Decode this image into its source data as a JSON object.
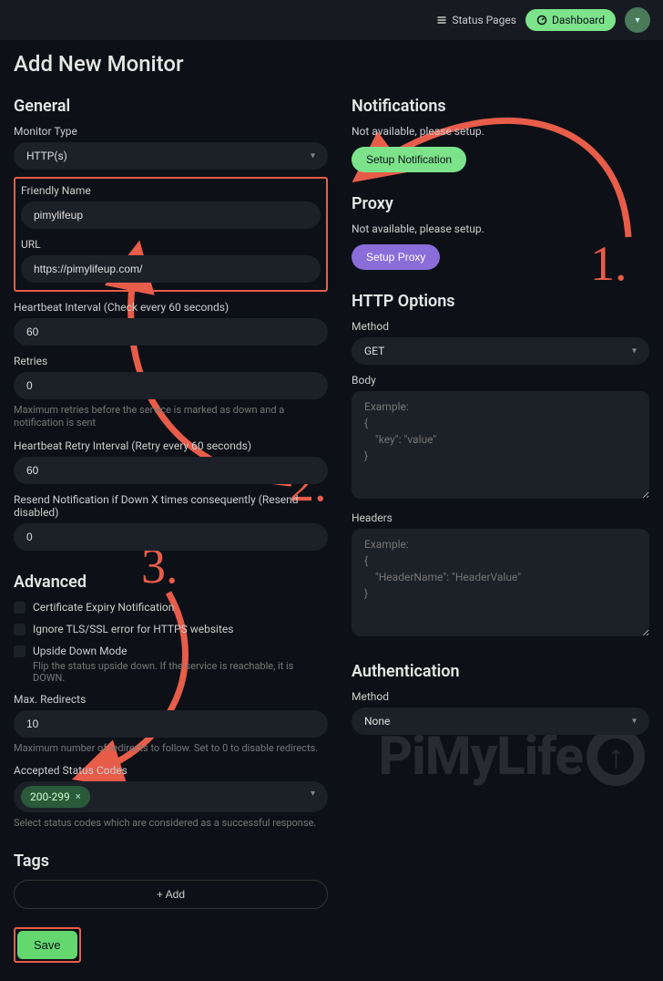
{
  "topbar": {
    "status_pages": "Status Pages",
    "dashboard": "Dashboard"
  },
  "page_title": "Add New Monitor",
  "general": {
    "heading": "General",
    "monitor_type_label": "Monitor Type",
    "monitor_type_value": "HTTP(s)",
    "friendly_name_label": "Friendly Name",
    "friendly_name_value": "pimylifeup",
    "url_label": "URL",
    "url_value": "https://pimylifeup.com/",
    "heartbeat_interval_label": "Heartbeat Interval (Check every 60 seconds)",
    "heartbeat_interval_value": "60",
    "retries_label": "Retries",
    "retries_value": "0",
    "retries_hint": "Maximum retries before the service is marked as down and a notification is sent",
    "retry_interval_label": "Heartbeat Retry Interval (Retry every 60 seconds)",
    "retry_interval_value": "60",
    "resend_label": "Resend Notification if Down X times consequently (Resend disabled)",
    "resend_value": "0"
  },
  "advanced": {
    "heading": "Advanced",
    "cert_expiry": "Certificate Expiry Notification",
    "ignore_tls": "Ignore TLS/SSL error for HTTPS websites",
    "upside_down": "Upside Down Mode",
    "upside_down_hint": "Flip the status upside down. If the service is reachable, it is DOWN.",
    "max_redirects_label": "Max. Redirects",
    "max_redirects_value": "10",
    "max_redirects_hint": "Maximum number of redirects to follow. Set to 0 to disable redirects.",
    "status_codes_label": "Accepted Status Codes",
    "status_codes_chip": "200-299",
    "status_codes_hint": "Select status codes which are considered as a successful response."
  },
  "tags": {
    "heading": "Tags",
    "add_btn": "+ Add"
  },
  "save_btn": "Save",
  "notifications": {
    "heading": "Notifications",
    "not_available": "Not available, please setup.",
    "setup_btn": "Setup Notification"
  },
  "proxy": {
    "heading": "Proxy",
    "not_available": "Not available, please setup.",
    "setup_btn": "Setup Proxy"
  },
  "http_options": {
    "heading": "HTTP Options",
    "method_label": "Method",
    "method_value": "GET",
    "body_label": "Body",
    "body_placeholder": "Example:\n{\n    \"key\": \"value\"\n}",
    "headers_label": "Headers",
    "headers_placeholder": "Example:\n{\n    \"HeaderName\": \"HeaderValue\"\n}"
  },
  "auth": {
    "heading": "Authentication",
    "method_label": "Method",
    "method_value": "None"
  },
  "annotations": {
    "n1": "1.",
    "n2": "2.",
    "n3": "3."
  },
  "watermark": "PiMyLife"
}
